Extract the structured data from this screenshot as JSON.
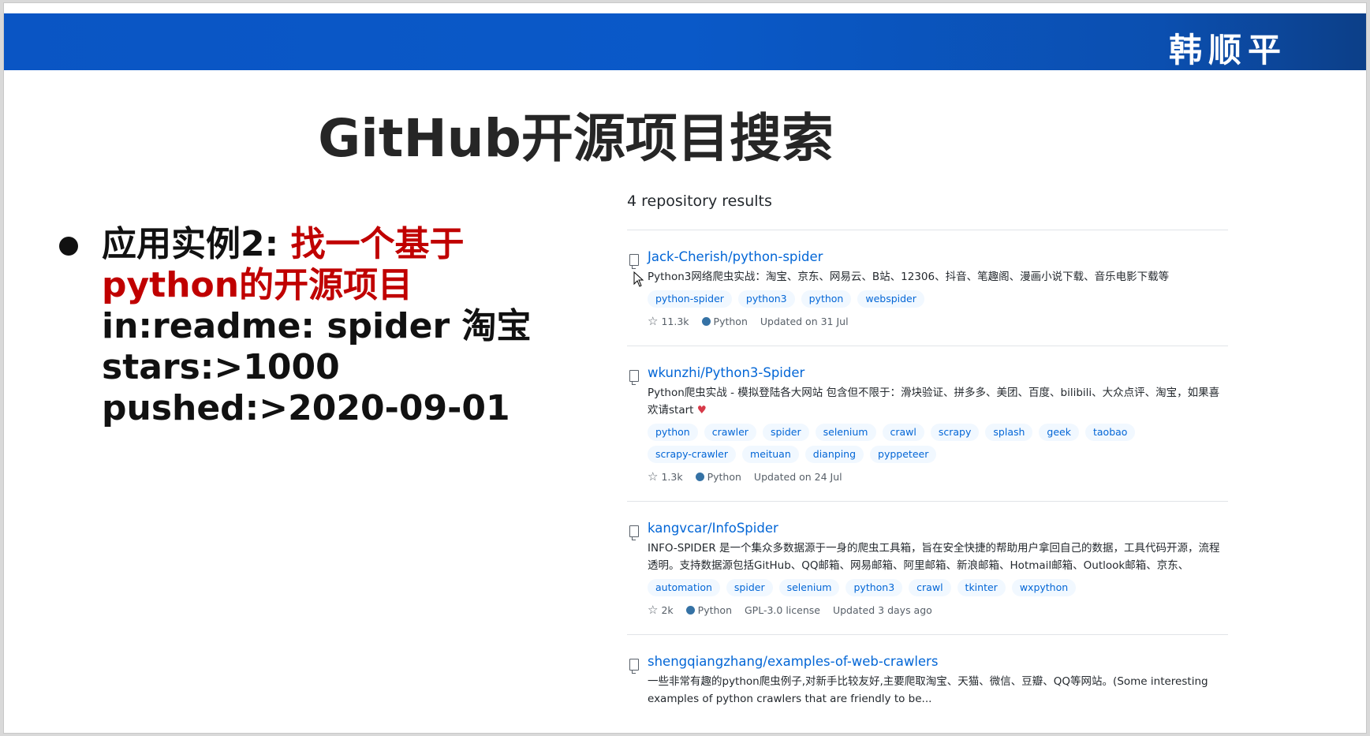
{
  "banner": {
    "name": "韩顺平"
  },
  "slide": {
    "title": "GitHub开源项目搜索",
    "bullet": {
      "prefix": "应用实例2: ",
      "red_line1": "找一个基于",
      "red_line2": "python的开源项目",
      "lines": [
        "in:readme: spider 淘宝",
        "stars:>1000",
        "pushed:>2020-09-01"
      ]
    }
  },
  "results": {
    "header": "4 repository results",
    "repos": [
      {
        "name": "Jack-Cherish/python-spider",
        "description": "Python3网络爬虫实战：淘宝、京东、网易云、B站、12306、抖音、笔趣阁、漫画小说下载、音乐电影下载等",
        "topics": [
          "python-spider",
          "python3",
          "python",
          "webspider"
        ],
        "stars": "11.3k",
        "language": "Python",
        "updated": "Updated on 31 Jul"
      },
      {
        "name": "wkunzhi/Python3-Spider",
        "description": "Python爬虫实战 - 模拟登陆各大网站 包含但不限于：滑块验证、拼多多、美团、百度、bilibili、大众点评、淘宝，如果喜欢请start",
        "topics": [
          "python",
          "crawler",
          "spider",
          "selenium",
          "crawl",
          "scrapy",
          "splash",
          "geek",
          "taobao",
          "scrapy-crawler",
          "meituan",
          "dianping",
          "pyppeteer"
        ],
        "stars": "1.3k",
        "language": "Python",
        "updated": "Updated on 24 Jul"
      },
      {
        "name": "kangvcar/InfoSpider",
        "description": "INFO-SPIDER 是一个集众多数据源于一身的爬虫工具箱，旨在安全快捷的帮助用户拿回自己的数据，工具代码开源，流程透明。支持数据源包括GitHub、QQ邮箱、网易邮箱、阿里邮箱、新浪邮箱、Hotmail邮箱、Outlook邮箱、京东、",
        "topics": [
          "automation",
          "spider",
          "selenium",
          "python3",
          "crawl",
          "tkinter",
          "wxpython"
        ],
        "stars": "2k",
        "language": "Python",
        "license": "GPL-3.0 license",
        "updated": "Updated 3 days ago"
      },
      {
        "name": "shengqiangzhang/examples-of-web-crawlers",
        "description": "一些非常有趣的python爬虫例子,对新手比较友好,主要爬取淘宝、天猫、微信、豆瓣、QQ等网站。(Some interesting examples of python crawlers that are friendly to be..."
      }
    ]
  },
  "colors": {
    "link": "#0366d6",
    "topic_bg": "#f1f8ff",
    "accent_red": "#c00000",
    "banner_blue": "#0a55c4",
    "python_lang": "#3572A5"
  }
}
